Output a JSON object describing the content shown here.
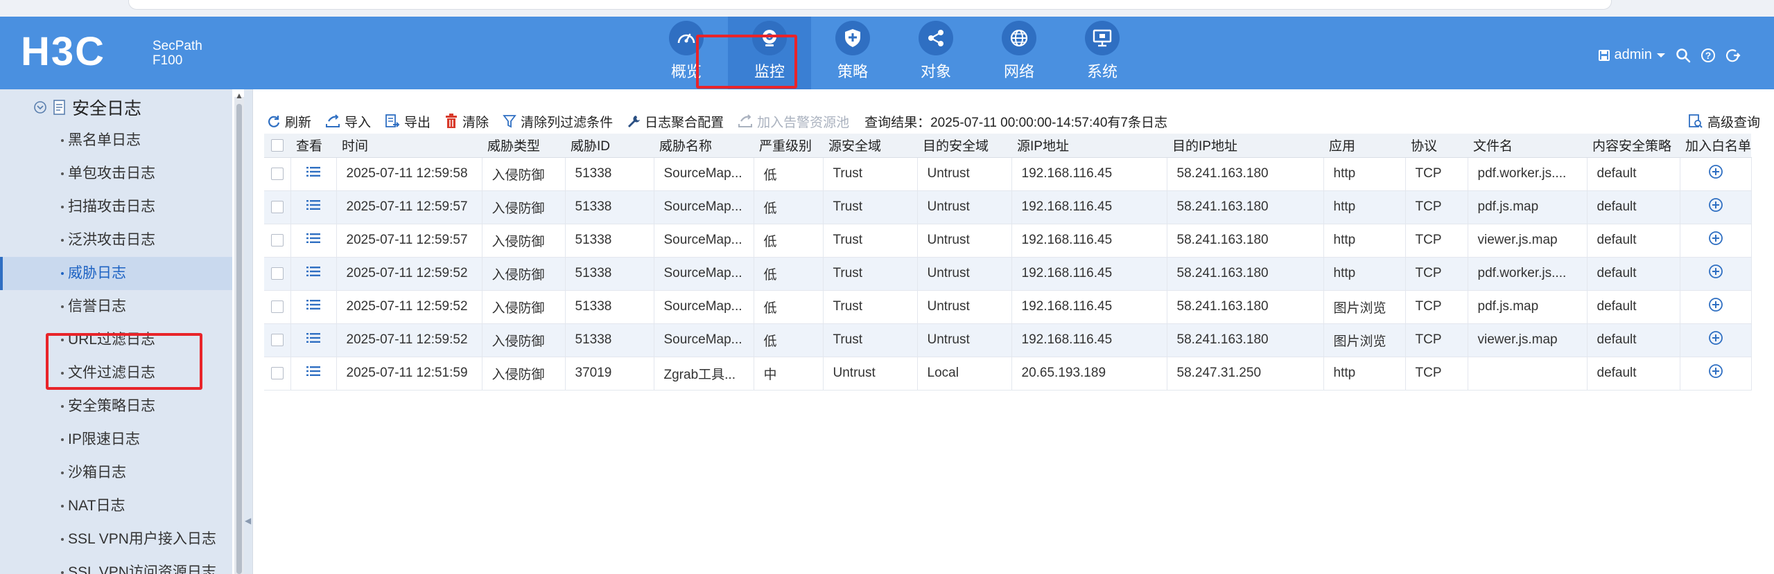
{
  "brand": {
    "logo_text": "H3C",
    "product_line1": "SecPath",
    "product_line2": "F100"
  },
  "nav": [
    {
      "label": "概览",
      "icon": "gauge-icon"
    },
    {
      "label": "监控",
      "icon": "camera-icon",
      "active": true
    },
    {
      "label": "策略",
      "icon": "shield-plus-icon"
    },
    {
      "label": "对象",
      "icon": "share-nodes-icon"
    },
    {
      "label": "网络",
      "icon": "globe-icon"
    },
    {
      "label": "系统",
      "icon": "monitor-icon"
    }
  ],
  "header_right": {
    "user": "admin"
  },
  "sidebar": {
    "title": "安全日志",
    "items": [
      {
        "label": "黑名单日志"
      },
      {
        "label": "单包攻击日志"
      },
      {
        "label": "扫描攻击日志"
      },
      {
        "label": "泛洪攻击日志"
      },
      {
        "label": "威胁日志",
        "active": true
      },
      {
        "label": "信誉日志"
      },
      {
        "label": "URL过滤日志"
      },
      {
        "label": "文件过滤日志"
      },
      {
        "label": "安全策略日志"
      },
      {
        "label": "IP限速日志"
      },
      {
        "label": "沙箱日志"
      },
      {
        "label": "NAT日志"
      },
      {
        "label": "SSL VPN用户接入日志"
      },
      {
        "label": "SSL VPN访问资源日志"
      }
    ]
  },
  "toolbar": {
    "refresh": "刷新",
    "import": "导入",
    "export": "导出",
    "clear": "清除",
    "clear_filter": "清除列过滤条件",
    "log_aggregation": "日志聚合配置",
    "add_alarm_pool": "加入告警资源池",
    "query_result": "查询结果：2025-07-11 00:00:00-14:57:40有7条日志",
    "advanced_query": "高级查询"
  },
  "table": {
    "columns": [
      "查看",
      "时间",
      "威胁类型",
      "威胁ID",
      "威胁名称",
      "严重级别",
      "源安全域",
      "目的安全域",
      "源IP地址",
      "目的IP地址",
      "应用",
      "协议",
      "文件名",
      "内容安全策略",
      "加入白名单"
    ],
    "rows": [
      [
        "2025-07-11 12:59:58",
        "入侵防御",
        "51338",
        "SourceMap...",
        "低",
        "Trust",
        "Untrust",
        "192.168.116.45",
        "58.241.163.180",
        "http",
        "TCP",
        "pdf.worker.js....",
        "default"
      ],
      [
        "2025-07-11 12:59:57",
        "入侵防御",
        "51338",
        "SourceMap...",
        "低",
        "Trust",
        "Untrust",
        "192.168.116.45",
        "58.241.163.180",
        "http",
        "TCP",
        "pdf.js.map",
        "default"
      ],
      [
        "2025-07-11 12:59:57",
        "入侵防御",
        "51338",
        "SourceMap...",
        "低",
        "Trust",
        "Untrust",
        "192.168.116.45",
        "58.241.163.180",
        "http",
        "TCP",
        "viewer.js.map",
        "default"
      ],
      [
        "2025-07-11 12:59:52",
        "入侵防御",
        "51338",
        "SourceMap...",
        "低",
        "Trust",
        "Untrust",
        "192.168.116.45",
        "58.241.163.180",
        "http",
        "TCP",
        "pdf.worker.js....",
        "default"
      ],
      [
        "2025-07-11 12:59:52",
        "入侵防御",
        "51338",
        "SourceMap...",
        "低",
        "Trust",
        "Untrust",
        "192.168.116.45",
        "58.241.163.180",
        "图片浏览",
        "TCP",
        "pdf.js.map",
        "default"
      ],
      [
        "2025-07-11 12:59:52",
        "入侵防御",
        "51338",
        "SourceMap...",
        "低",
        "Trust",
        "Untrust",
        "192.168.116.45",
        "58.241.163.180",
        "图片浏览",
        "TCP",
        "viewer.js.map",
        "default"
      ],
      [
        "2025-07-11 12:51:59",
        "入侵防御",
        "37019",
        "Zgrab工具...",
        "中",
        "Untrust",
        "Local",
        "20.65.193.189",
        "58.247.31.250",
        "http",
        "TCP",
        "",
        "default"
      ]
    ]
  },
  "colors": {
    "header_bg": "#4a90e0",
    "nav_circle": "#2f6fc2",
    "highlight_red": "#e8242a",
    "sidebar_bg": "#dde6f2",
    "link_blue": "#1e63c3"
  }
}
